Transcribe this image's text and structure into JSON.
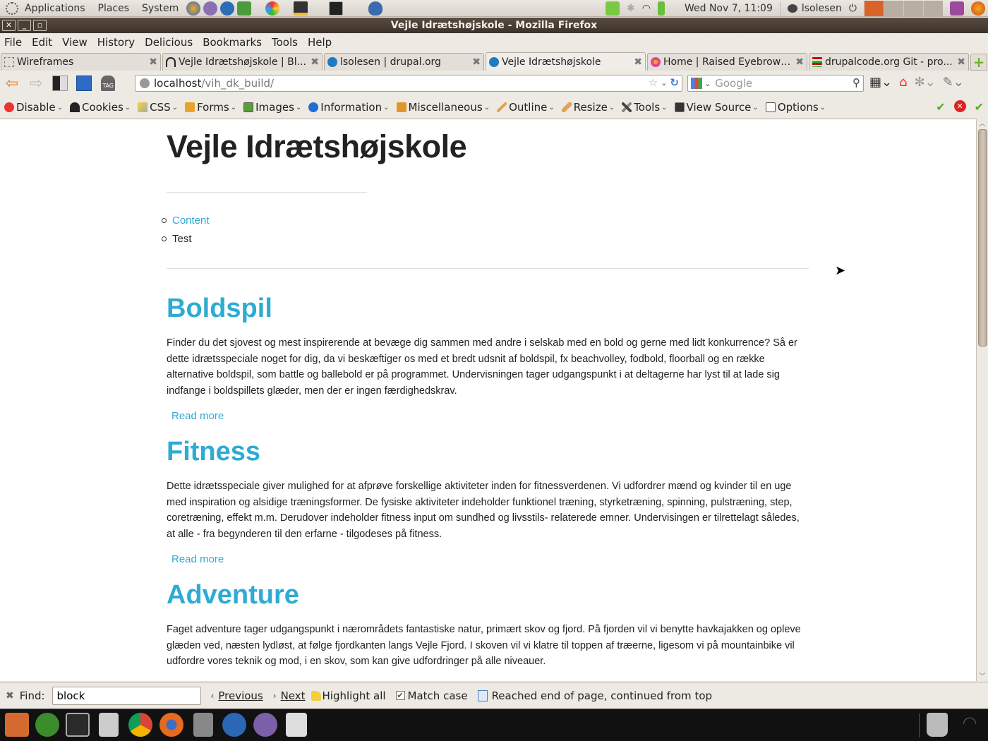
{
  "top_panel": {
    "menus": [
      "Applications",
      "Places",
      "System"
    ],
    "clock": "Wed Nov 7, 11:09",
    "user": "lsolesen"
  },
  "window": {
    "title": "Vejle Idrætshøjskole - Mozilla Firefox"
  },
  "menu_bar": {
    "items": [
      "File",
      "Edit",
      "View",
      "History",
      "Delicious",
      "Bookmarks",
      "Tools",
      "Help"
    ]
  },
  "tabs": [
    {
      "label": "Wireframes",
      "icon": "dotted-page-icon",
      "active": false
    },
    {
      "label": "Vejle Idrætshøjskole | Bl...",
      "icon": "loading-icon",
      "active": false
    },
    {
      "label": "lsolesen | drupal.org",
      "icon": "drupal-icon",
      "active": false
    },
    {
      "label": "Vejle Idrætshøjskole",
      "icon": "drupal-icon",
      "active": true
    },
    {
      "label": "Home | Raised Eyebrow ...",
      "icon": "flower-icon",
      "active": false
    },
    {
      "label": "drupalcode.org Git - pro...",
      "icon": "git-icon",
      "active": false
    }
  ],
  "nav": {
    "url_host": "localhost",
    "url_path": "/vih_dk_build/",
    "search_placeholder": "Google"
  },
  "webdev_toolbar": {
    "items": [
      "Disable",
      "Cookies",
      "CSS",
      "Forms",
      "Images",
      "Information",
      "Miscellaneous",
      "Outline",
      "Resize",
      "Tools",
      "View Source",
      "Options"
    ]
  },
  "page": {
    "site_title": "Vejle Idrætshøjskole",
    "nav_links": [
      {
        "label": "Content",
        "is_link": true
      },
      {
        "label": "Test",
        "is_link": false
      }
    ],
    "articles": [
      {
        "title": "Boldspil",
        "body": "Finder du det sjovest og mest inspirerende at bevæge dig sammen med andre i selskab med en bold og gerne med lidt konkurrence? Så er dette idrætsspeciale noget for dig, da vi beskæftiger os med et bredt udsnit af boldspil, fx beachvolley, fodbold, floorball og en række alternative boldspil, som battle og ballebold er på programmet. Undervisningen tager udgangspunkt i at deltagerne har lyst til at lade sig indfange i boldspillets glæder, men der er ingen færdighedskrav.",
        "read_more": "Read more"
      },
      {
        "title": "Fitness",
        "body": "Dette idrætsspeciale giver mulighed for at afprøve forskellige aktiviteter inden for fitnessverdenen. Vi udfordrer mænd og kvinder til en uge med inspiration og alsidige træningsformer. De fysiske aktiviteter indeholder funktionel træning, styrketræning, spinning, pulstræning, step, coretræning, effekt m.m. Derudover indeholder fitness input om sundhed og livsstils- relaterede emner. Undervisingen er tilrettelagt således, at alle - fra begynderen til den erfarne - tilgodeses på fitness.",
        "read_more": "Read more"
      },
      {
        "title": "Adventure",
        "body": "Faget adventure tager udgangspunkt i nærområdets fantastiske natur, primært skov og fjord. På fjorden vil vi benytte havkajakken og opleve glæden ved, næsten lydløst, at følge fjordkanten langs Vejle Fjord. I skoven vil vi klatre til toppen af træerne, ligesom vi på mountainbike vil udfordre vores teknik og mod, i en skov, som kan give udfordringer på alle niveauer.",
        "read_more": "Read more"
      }
    ]
  },
  "find_bar": {
    "label": "Find:",
    "query": "block",
    "previous": "Previous",
    "next": "Next",
    "highlight_all": "Highlight all",
    "match_case": "Match case",
    "match_case_checked": true,
    "status": "Reached end of page, continued from top"
  },
  "colors": {
    "link": "#2fa9d4",
    "heading": "#2eabd3",
    "titlebar": "#3c322b"
  }
}
